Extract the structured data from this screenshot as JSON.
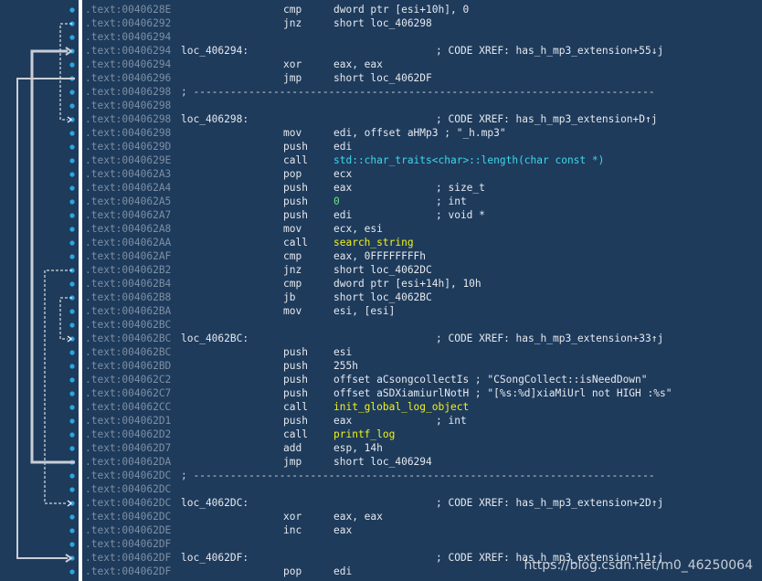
{
  "lines": [
    {
      "addr": ".text:0040628E",
      "label": "",
      "mnem": "cmp",
      "operand": "dword ptr [esi+10h], 0",
      "operand_style": "",
      "comment": ""
    },
    {
      "addr": ".text:00406292",
      "label": "",
      "mnem": "jnz",
      "operand": "short loc_406298",
      "operand_style": "",
      "comment": ""
    },
    {
      "addr": ".text:00406294",
      "label": "",
      "mnem": "",
      "operand": "",
      "operand_style": "",
      "comment": ""
    },
    {
      "addr": ".text:00406294",
      "label": "loc_406294:",
      "mnem": "",
      "operand": "",
      "operand_style": "",
      "comment": "; CODE XREF: has_h_mp3_extension+55↓j"
    },
    {
      "addr": ".text:00406294",
      "label": "",
      "mnem": "xor",
      "operand": "eax, eax",
      "operand_style": "",
      "comment": ""
    },
    {
      "addr": ".text:00406296",
      "label": "",
      "mnem": "jmp",
      "operand": "short loc_4062DF",
      "operand_style": "",
      "comment": ""
    },
    {
      "addr": ".text:00406298",
      "separator": "; ---------------------------------------------------------------------------"
    },
    {
      "addr": ".text:00406298",
      "label": "",
      "mnem": "",
      "operand": "",
      "operand_style": "",
      "comment": ""
    },
    {
      "addr": ".text:00406298",
      "label": "loc_406298:",
      "mnem": "",
      "operand": "",
      "operand_style": "",
      "comment": "; CODE XREF: has_h_mp3_extension+D↑j"
    },
    {
      "addr": ".text:00406298",
      "label": "",
      "mnem": "mov",
      "operand": "edi, offset aHMp3 ; \"_h.mp3\"",
      "operand_style": "",
      "comment": ""
    },
    {
      "addr": ".text:0040629D",
      "label": "",
      "mnem": "push",
      "operand": "edi",
      "operand_style": "",
      "comment": ""
    },
    {
      "addr": ".text:0040629E",
      "label": "",
      "mnem": "call",
      "operand": "std::char_traits<char>::length(char const *)",
      "operand_style": "cy",
      "comment": ""
    },
    {
      "addr": ".text:004062A3",
      "label": "",
      "mnem": "pop",
      "operand": "ecx",
      "operand_style": "",
      "comment": ""
    },
    {
      "addr": ".text:004062A4",
      "label": "",
      "mnem": "push",
      "operand": "eax",
      "operand_style": "",
      "comment": "; size_t"
    },
    {
      "addr": ".text:004062A5",
      "label": "",
      "mnem": "push",
      "operand": "0",
      "operand_style": "nm",
      "comment": "; int"
    },
    {
      "addr": ".text:004062A7",
      "label": "",
      "mnem": "push",
      "operand": "edi",
      "operand_style": "",
      "comment": "; void *"
    },
    {
      "addr": ".text:004062A8",
      "label": "",
      "mnem": "mov",
      "operand": "ecx, esi",
      "operand_style": "",
      "comment": ""
    },
    {
      "addr": ".text:004062AA",
      "label": "",
      "mnem": "call",
      "operand": "search_string",
      "operand_style": "hl",
      "comment": ""
    },
    {
      "addr": ".text:004062AF",
      "label": "",
      "mnem": "cmp",
      "operand": "eax, 0FFFFFFFFh",
      "operand_style": "",
      "comment": ""
    },
    {
      "addr": ".text:004062B2",
      "label": "",
      "mnem": "jnz",
      "operand": "short loc_4062DC",
      "operand_style": "",
      "comment": ""
    },
    {
      "addr": ".text:004062B4",
      "label": "",
      "mnem": "cmp",
      "operand": "dword ptr [esi+14h], 10h",
      "operand_style": "",
      "comment": ""
    },
    {
      "addr": ".text:004062B8",
      "label": "",
      "mnem": "jb",
      "operand": "short loc_4062BC",
      "operand_style": "",
      "comment": ""
    },
    {
      "addr": ".text:004062BA",
      "label": "",
      "mnem": "mov",
      "operand": "esi, [esi]",
      "operand_style": "",
      "comment": ""
    },
    {
      "addr": ".text:004062BC",
      "label": "",
      "mnem": "",
      "operand": "",
      "operand_style": "",
      "comment": ""
    },
    {
      "addr": ".text:004062BC",
      "label": "loc_4062BC:",
      "mnem": "",
      "operand": "",
      "operand_style": "",
      "comment": "; CODE XREF: has_h_mp3_extension+33↑j"
    },
    {
      "addr": ".text:004062BC",
      "label": "",
      "mnem": "push",
      "operand": "esi",
      "operand_style": "",
      "comment": ""
    },
    {
      "addr": ".text:004062BD",
      "label": "",
      "mnem": "push",
      "operand": "255h",
      "operand_style": "",
      "comment": ""
    },
    {
      "addr": ".text:004062C2",
      "label": "",
      "mnem": "push",
      "operand": "offset aCsongcollectIs ; \"CSongCollect::isNeedDown\"",
      "operand_style": "",
      "comment": ""
    },
    {
      "addr": ".text:004062C7",
      "label": "",
      "mnem": "push",
      "operand": "offset aSDXiamiurlNotH ; \"[%s:%d]xiaMiUrl not HIGH :%s\"",
      "operand_style": "",
      "comment": ""
    },
    {
      "addr": ".text:004062CC",
      "label": "",
      "mnem": "call",
      "operand": "init_global_log_object",
      "operand_style": "hl",
      "comment": ""
    },
    {
      "addr": ".text:004062D1",
      "label": "",
      "mnem": "push",
      "operand": "eax",
      "operand_style": "",
      "comment": "; int"
    },
    {
      "addr": ".text:004062D2",
      "label": "",
      "mnem": "call",
      "operand": "printf_log",
      "operand_style": "hl",
      "comment": ""
    },
    {
      "addr": ".text:004062D7",
      "label": "",
      "mnem": "add",
      "operand": "esp, 14h",
      "operand_style": "",
      "comment": ""
    },
    {
      "addr": ".text:004062DA",
      "label": "",
      "mnem": "jmp",
      "operand": "short loc_406294",
      "operand_style": "",
      "comment": ""
    },
    {
      "addr": ".text:004062DC",
      "separator": "; ---------------------------------------------------------------------------"
    },
    {
      "addr": ".text:004062DC",
      "label": "",
      "mnem": "",
      "operand": "",
      "operand_style": "",
      "comment": ""
    },
    {
      "addr": ".text:004062DC",
      "label": "loc_4062DC:",
      "mnem": "",
      "operand": "",
      "operand_style": "",
      "comment": "; CODE XREF: has_h_mp3_extension+2D↑j"
    },
    {
      "addr": ".text:004062DC",
      "label": "",
      "mnem": "xor",
      "operand": "eax, eax",
      "operand_style": "",
      "comment": ""
    },
    {
      "addr": ".text:004062DE",
      "label": "",
      "mnem": "inc",
      "operand": "eax",
      "operand_style": "",
      "comment": ""
    },
    {
      "addr": ".text:004062DF",
      "label": "",
      "mnem": "",
      "operand": "",
      "operand_style": "",
      "comment": ""
    },
    {
      "addr": ".text:004062DF",
      "label": "loc_4062DF:",
      "mnem": "",
      "operand": "",
      "operand_style": "",
      "comment": "; CODE XREF: has_h_mp3_extension+11↑j"
    },
    {
      "addr": ".text:004062DF",
      "label": "",
      "mnem": "pop",
      "operand": "edi",
      "operand_style": "",
      "comment": ""
    }
  ],
  "watermark": "https://blog.csdn.net/m0_46250064",
  "colors": {
    "background": "#1e3b5c",
    "address": "#7d8fa3",
    "text": "#e6e9ee",
    "call_target_highlight": "#f1f21a",
    "library_call": "#3fd7ea",
    "number": "#6fe08a",
    "branch_dot": "#2aa7e0"
  }
}
